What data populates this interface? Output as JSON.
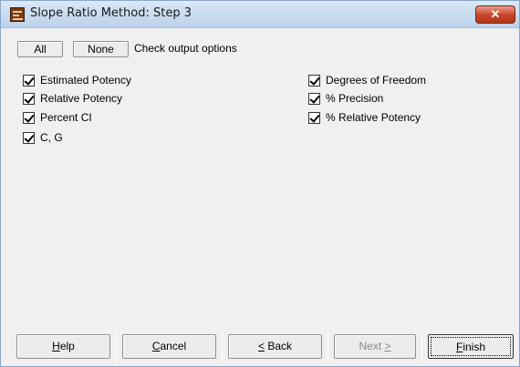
{
  "window": {
    "title": "Slope Ratio Method: Step 3",
    "close_glyph": "✕",
    "app_icon": "spreadsheet-app-icon"
  },
  "toolbar": {
    "all_label": "All",
    "none_label": "None",
    "check_label": "Check output options"
  },
  "options_left": [
    {
      "label": "Estimated Potency",
      "checked": true
    },
    {
      "label": "Relative Potency",
      "checked": true
    },
    {
      "label": "Percent CI",
      "checked": true
    },
    {
      "label": "C, G",
      "checked": true
    }
  ],
  "options_right": [
    {
      "label": "Degrees of Freedom",
      "checked": true
    },
    {
      "label": "% Precision",
      "checked": true
    },
    {
      "label": "% Relative Potency",
      "checked": true
    }
  ],
  "buttons": {
    "help": {
      "pre": "",
      "key": "H",
      "post": "elp"
    },
    "cancel": {
      "pre": "",
      "key": "C",
      "post": "ancel"
    },
    "back": {
      "pre": "",
      "key": "<",
      "post": " Back"
    },
    "next": {
      "pre": "Next ",
      "key": ">",
      "post": ""
    },
    "finish": {
      "pre": "",
      "key": "F",
      "post": "inish"
    }
  },
  "colors": {
    "title_bar": "#c8dbef",
    "close_button": "#c9482c",
    "dialog_bg": "#f0f0f0"
  }
}
